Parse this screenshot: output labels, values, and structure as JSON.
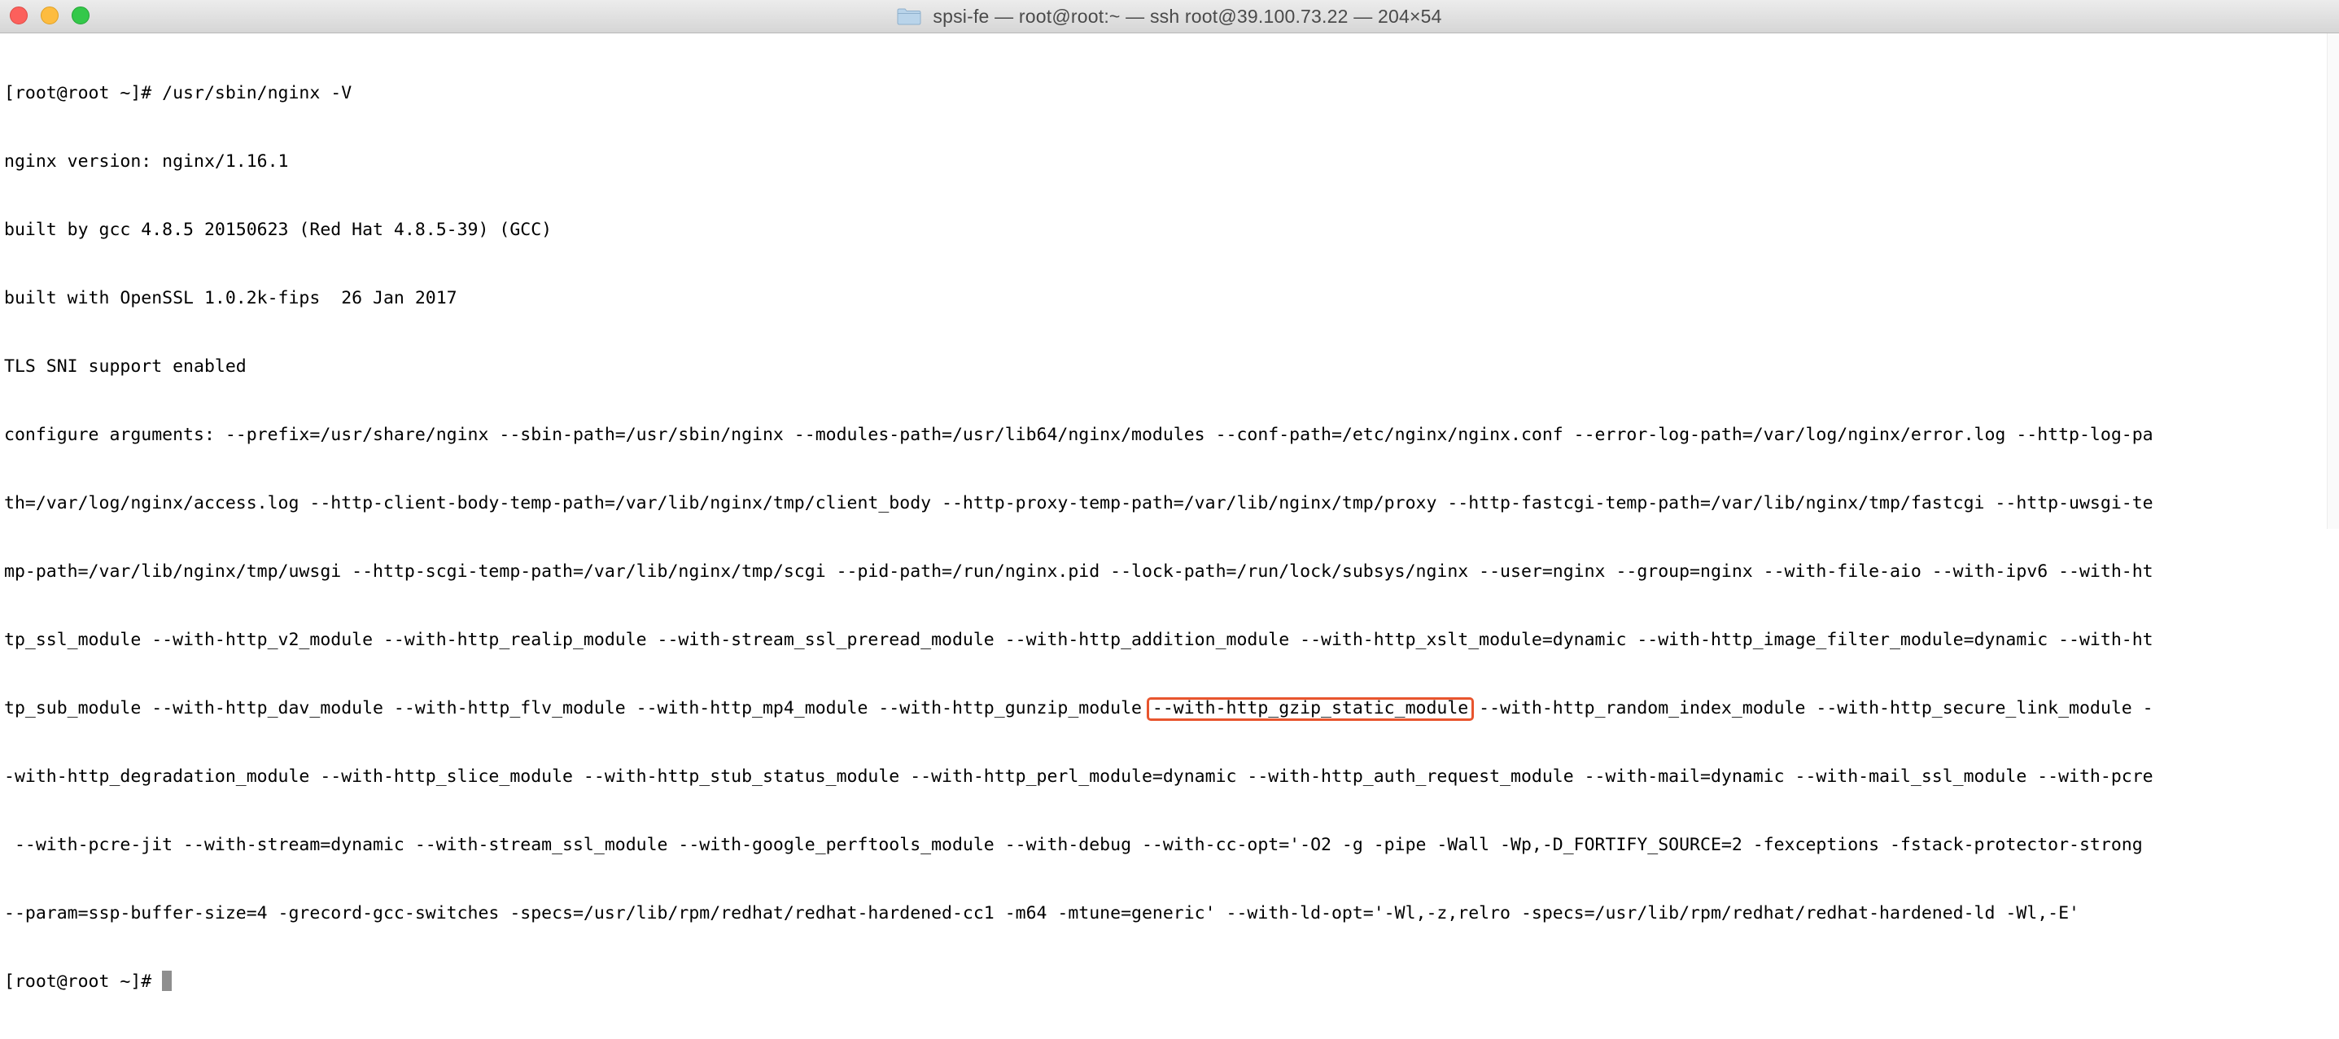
{
  "window": {
    "title": "spsi-fe — root@root:~ — ssh root@39.100.73.22 — 204×54",
    "folder_icon": "folder-icon",
    "colors": {
      "close": "#fc605c",
      "minimize": "#fdbc40",
      "maximize": "#34c84a",
      "highlight_box": "#e8552e"
    }
  },
  "terminal": {
    "lines": [
      "[root@root ~]# /usr/sbin/nginx -V",
      "nginx version: nginx/1.16.1",
      "built by gcc 4.8.5 20150623 (Red Hat 4.8.5-39) (GCC)",
      "built with OpenSSL 1.0.2k-fips  26 Jan 2017",
      "TLS SNI support enabled",
      "configure arguments: --prefix=/usr/share/nginx --sbin-path=/usr/sbin/nginx --modules-path=/usr/lib64/nginx/modules --conf-path=/etc/nginx/nginx.conf --error-log-path=/var/log/nginx/error.log --http-log-pa",
      "th=/var/log/nginx/access.log --http-client-body-temp-path=/var/lib/nginx/tmp/client_body --http-proxy-temp-path=/var/lib/nginx/tmp/proxy --http-fastcgi-temp-path=/var/lib/nginx/tmp/fastcgi --http-uwsgi-te",
      "mp-path=/var/lib/nginx/tmp/uwsgi --http-scgi-temp-path=/var/lib/nginx/tmp/scgi --pid-path=/run/nginx.pid --lock-path=/run/lock/subsys/nginx --user=nginx --group=nginx --with-file-aio --with-ipv6 --with-ht",
      "tp_ssl_module --with-http_v2_module --with-http_realip_module --with-stream_ssl_preread_module --with-http_addition_module --with-http_xslt_module=dynamic --with-http_image_filter_module=dynamic --with-ht"
    ],
    "highlight_line": {
      "before": "tp_sub_module --with-http_dav_module --with-http_flv_module --with-http_mp4_module --with-http_gunzip_module ",
      "highlight": "--with-http_gzip_static_module",
      "after": " --with-http_random_index_module --with-http_secure_link_module -"
    },
    "lines_after": [
      "-with-http_degradation_module --with-http_slice_module --with-http_stub_status_module --with-http_perl_module=dynamic --with-http_auth_request_module --with-mail=dynamic --with-mail_ssl_module --with-pcre",
      " --with-pcre-jit --with-stream=dynamic --with-stream_ssl_module --with-google_perftools_module --with-debug --with-cc-opt='-O2 -g -pipe -Wall -Wp,-D_FORTIFY_SOURCE=2 -fexceptions -fstack-protector-strong",
      "--param=ssp-buffer-size=4 -grecord-gcc-switches -specs=/usr/lib/rpm/redhat/redhat-hardened-cc1 -m64 -mtune=generic' --with-ld-opt='-Wl,-z,relro -specs=/usr/lib/rpm/redhat/redhat-hardened-ld -Wl,-E'"
    ],
    "prompt": "[root@root ~]# "
  }
}
